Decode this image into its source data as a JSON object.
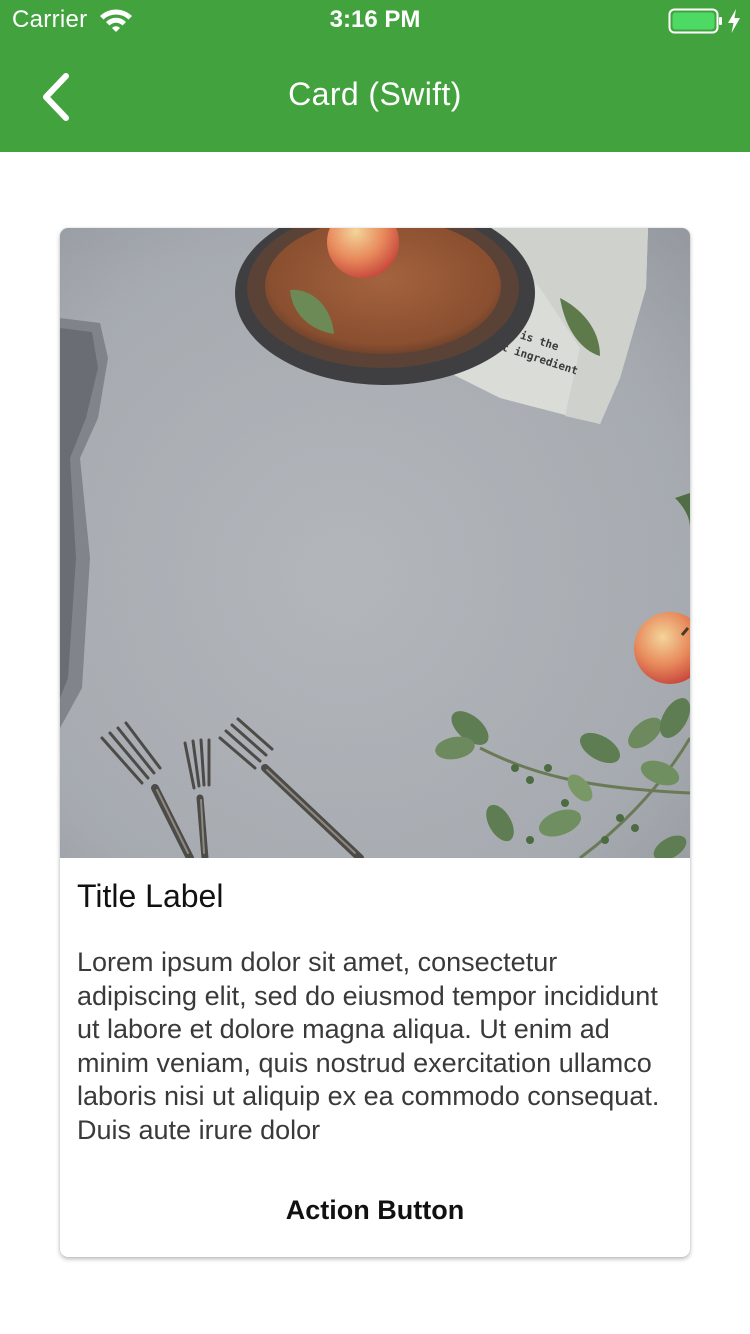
{
  "status_bar": {
    "carrier": "Carrier",
    "time": "3:16 PM",
    "wifi_icon": "wifi-icon",
    "battery_icon": "battery-icon",
    "charging_icon": "bolt-icon"
  },
  "nav": {
    "title": "Card (Swift)",
    "back_icon": "chevron-left-icon"
  },
  "card": {
    "image_description": "flat-lay-table-photo",
    "image_text": "LOVE is the best ingredient",
    "title": "Title Label",
    "body": "Lorem ipsum dolor sit amet, consectetur adipiscing elit, sed do eiusmod tempor incididunt ut labore et dolore magna aliqua. Ut enim ad minim veniam, quis nostrud exercitation ullamco laboris nisi ut aliquip ex ea commodo consequat. Duis aute irure dolor",
    "action_label": "Action Button"
  },
  "colors": {
    "nav_background": "#42a33e",
    "battery_fill": "#4cd964",
    "surface_gray": "#a3a8ae"
  }
}
